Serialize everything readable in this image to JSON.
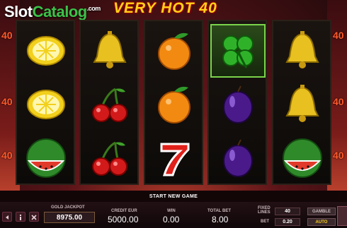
{
  "branding": {
    "site_name_part1": "Slot",
    "site_name_part2": "Catalog",
    "site_suffix": ".com",
    "game_title": "VERY HOT 40"
  },
  "side_numbers": {
    "left": [
      "40",
      "40",
      "40"
    ],
    "right": [
      "40",
      "40",
      "40"
    ]
  },
  "reels": [
    [
      "lemon",
      "lemon",
      "watermelon"
    ],
    [
      "bell",
      "cherry",
      "cherry"
    ],
    [
      "orange",
      "orange",
      "seven"
    ],
    [
      "clover",
      "plum",
      "plum"
    ],
    [
      "bell",
      "bell",
      "watermelon"
    ]
  ],
  "highlighted_cell": {
    "reel": 3,
    "row": 0
  },
  "status_bar": {
    "message": "START NEW GAME"
  },
  "panel": {
    "jackpot_label": "GOLD JACKPOT",
    "jackpot_value": "8975.00",
    "credit_label": "CREDIT EUR",
    "credit_value": "5000.00",
    "win_label": "WIN",
    "win_value": "0.00",
    "total_bet_label": "TOTAL BET",
    "total_bet_value": "8.00",
    "fixed_lines_label": "FIXED LINES",
    "fixed_lines_value": "40",
    "bet_label": "BET",
    "bet_value": "0.20",
    "gamble_label": "GAMBLE",
    "auto_label": "AUTO"
  },
  "colors": {
    "accent_gold": "#ffd21a",
    "logo_green": "#3cc24a",
    "win_highlight": "#7ad44a"
  }
}
